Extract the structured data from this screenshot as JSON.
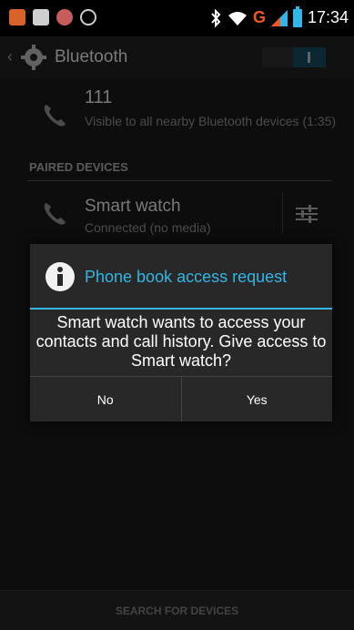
{
  "status_bar": {
    "time": "17:34",
    "network_label": "G",
    "left_icons": [
      "app-icon",
      "image-icon",
      "camera-icon",
      "circle-icon"
    ],
    "right_icons": [
      "bluetooth-icon",
      "wifi-icon",
      "signal-icon",
      "battery-icon"
    ],
    "accent": "#33b5e5"
  },
  "action_bar": {
    "title": "Bluetooth",
    "toggle_on": true
  },
  "this_device": {
    "name": "111",
    "subtitle": "Visible to all nearby Bluetooth devices (1:35)"
  },
  "paired_section": {
    "header": "PAIRED DEVICES",
    "devices": [
      {
        "name": "Smart watch",
        "status": "Connected (no media)"
      }
    ]
  },
  "dialog": {
    "title": "Phone book access request",
    "message": "Smart watch wants to access your contacts and call history. Give access to Smart watch?",
    "buttons": {
      "negative": "No",
      "positive": "Yes"
    }
  },
  "bottom_bar": {
    "search_label": "SEARCH FOR DEVICES"
  }
}
